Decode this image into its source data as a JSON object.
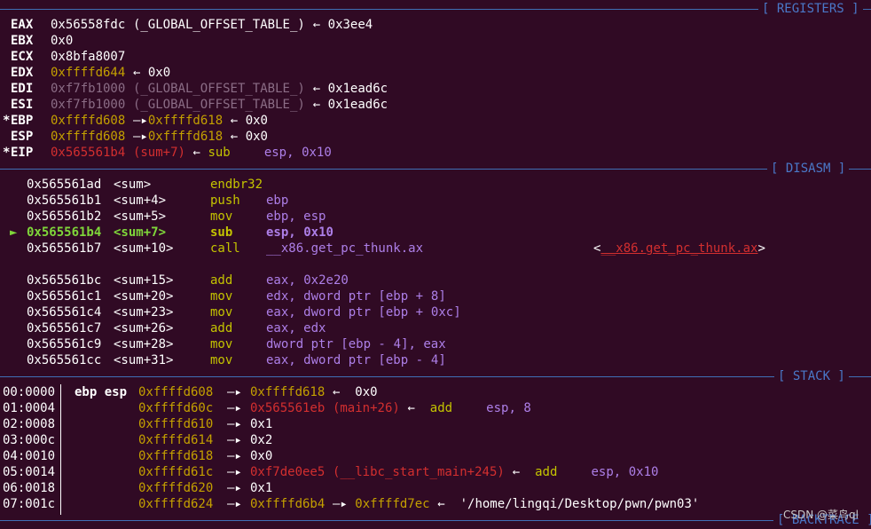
{
  "sections": {
    "registers": "[ REGISTERS ]",
    "disasm": "[ DISASM ]",
    "stack": "[ STACK ]",
    "backtrace": "[ BACKTRACE ]"
  },
  "registers": [
    {
      "mark": " ",
      "name": "EAX",
      "value": "0x56558fdc",
      "sym": "(_GLOBAL_OFFSET_TABLE_)",
      "arrow": "←",
      "target": "0x3ee4"
    },
    {
      "mark": " ",
      "name": "EBX",
      "value": "0x0"
    },
    {
      "mark": " ",
      "name": "ECX",
      "value": "0x8bfa8007"
    },
    {
      "mark": " ",
      "name": "EDX",
      "value": "0xffffd644",
      "arrow": "←",
      "target": "0x0"
    },
    {
      "mark": " ",
      "name": "EDI",
      "value": "0xf7fb1000",
      "sym": "(_GLOBAL_OFFSET_TABLE_)",
      "arrow": "←",
      "target": "0x1ead6c"
    },
    {
      "mark": " ",
      "name": "ESI",
      "value": "0xf7fb1000",
      "sym": "(_GLOBAL_OFFSET_TABLE_)",
      "arrow": "←",
      "target": "0x1ead6c"
    },
    {
      "mark": "*",
      "name": "EBP",
      "value": "0xffffd608",
      "arrow": "—▸",
      "mid": "0xffffd618",
      "arrow2": "←",
      "target": "0x0"
    },
    {
      "mark": " ",
      "name": "ESP",
      "value": "0xffffd608",
      "arrow": "—▸",
      "mid": "0xffffd618",
      "arrow2": "←",
      "target": "0x0"
    },
    {
      "mark": "*",
      "name": "EIP",
      "value": "0x565561b4",
      "sym": "(sum+7)",
      "arrow": "←",
      "ins": "sub",
      "ops": "esp,",
      "imm": "0x10"
    }
  ],
  "disasm": [
    {
      "cur": false,
      "addr": "0x565561ad",
      "sym": "<sum>",
      "mn": "endbr32",
      "ops": ""
    },
    {
      "cur": false,
      "addr": "0x565561b1",
      "sym": "<sum+4>",
      "mn": "push",
      "ops": "ebp"
    },
    {
      "cur": false,
      "addr": "0x565561b2",
      "sym": "<sum+5>",
      "mn": "mov",
      "ops": "ebp, esp"
    },
    {
      "cur": true,
      "marker": "►",
      "addr": "0x565561b4",
      "sym": "<sum+7>",
      "mn": "sub",
      "ops": "esp,",
      "imm": "0x10"
    },
    {
      "cur": false,
      "addr": "0x565561b7",
      "sym": "<sum+10>",
      "mn": "call",
      "ops": "__x86.get_pc_thunk.ax",
      "target": "__x86.get_pc_thunk.ax"
    },
    {
      "cur": false,
      "addr": "0x565561bc",
      "sym": "<sum+15>",
      "mn": "add",
      "ops": "eax,",
      "imm": "0x2e20"
    },
    {
      "cur": false,
      "addr": "0x565561c1",
      "sym": "<sum+20>",
      "mn": "mov",
      "ops": "edx, dword ptr [ebp +",
      "imm": "8",
      "tail": "]"
    },
    {
      "cur": false,
      "addr": "0x565561c4",
      "sym": "<sum+23>",
      "mn": "mov",
      "ops": "eax, dword ptr [ebp +",
      "imm": "0xc",
      "tail": "]"
    },
    {
      "cur": false,
      "addr": "0x565561c7",
      "sym": "<sum+26>",
      "mn": "add",
      "ops": "eax, edx"
    },
    {
      "cur": false,
      "addr": "0x565561c9",
      "sym": "<sum+28>",
      "mn": "mov",
      "ops": "dword ptr [ebp -",
      "imm": "4",
      "tail": "], eax"
    },
    {
      "cur": false,
      "addr": "0x565561cc",
      "sym": "<sum+31>",
      "mn": "mov",
      "ops": "eax, dword ptr [ebp -",
      "imm": "4",
      "tail": "]"
    }
  ],
  "stack": [
    {
      "idx": "00:0000",
      "regs": "ebp esp",
      "addr": "0xffffd608",
      "a1": "—▸",
      "v1": "0xffffd618",
      "a2": "←",
      "v2": "0x0"
    },
    {
      "idx": "01:0004",
      "regs": "",
      "addr": "0xffffd60c",
      "a1": "—▸",
      "v1": "0x565561eb",
      "sym": "(main+26)",
      "a2": "←",
      "ins": "add",
      "ops": "esp,",
      "imm": "8"
    },
    {
      "idx": "02:0008",
      "regs": "",
      "addr": "0xffffd610",
      "a1": "—▸",
      "v1": "0x1"
    },
    {
      "idx": "03:000c",
      "regs": "",
      "addr": "0xffffd614",
      "a1": "—▸",
      "v1": "0x2"
    },
    {
      "idx": "04:0010",
      "regs": "",
      "addr": "0xffffd618",
      "a1": "—▸",
      "v1": "0x0"
    },
    {
      "idx": "05:0014",
      "regs": "",
      "addr": "0xffffd61c",
      "a1": "—▸",
      "v1": "0xf7de0ee5",
      "sym": "(__libc_start_main+245)",
      "a2": "←",
      "ins": "add",
      "ops": "esp,",
      "imm": "0x10"
    },
    {
      "idx": "06:0018",
      "regs": "",
      "addr": "0xffffd620",
      "a1": "—▸",
      "v1": "0x1"
    },
    {
      "idx": "07:001c",
      "regs": "",
      "addr": "0xffffd624",
      "a1": "—▸",
      "v1": "0xffffd6b4",
      "a2": "—▸",
      "v2": "0xffffd7ec",
      "a3": "←",
      "str": "'/home/lingqi/Desktop/pwn/pwn03'"
    }
  ],
  "watermark": "CSDN @菜鸟ql"
}
